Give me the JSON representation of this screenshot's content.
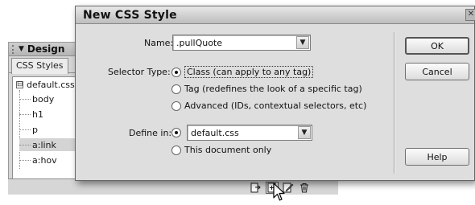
{
  "design_panel": {
    "title": "Design",
    "collapse_arrow": "▼",
    "tab_label": "CSS Styles",
    "tree": {
      "root_expander": "⊟",
      "root": "default.css",
      "items": [
        "body",
        "h1",
        "p",
        "a:link",
        "a:hov"
      ],
      "selected_index": 3
    },
    "toolbar_icons": [
      "attach-style-sheet-icon",
      "new-css-rule-icon",
      "edit-style-icon",
      "delete-icon"
    ]
  },
  "dialog": {
    "title": "New CSS Style",
    "close_glyph": "✕",
    "name": {
      "label": "Name:",
      "value": ".pullQuote"
    },
    "selector_type": {
      "label": "Selector Type:",
      "options": [
        {
          "label": "Class (can apply to any tag)",
          "checked": true
        },
        {
          "label": "Tag (redefines the look of a specific tag)",
          "checked": false
        },
        {
          "label": "Advanced (IDs, contextual selectors, etc)",
          "checked": false
        }
      ]
    },
    "define_in": {
      "label": "Define in:",
      "options": [
        {
          "label": "",
          "value": "default.css",
          "checked": true
        },
        {
          "label": "This document only",
          "checked": false
        }
      ]
    },
    "buttons": {
      "ok": "OK",
      "cancel": "Cancel",
      "help": "Help"
    },
    "dropdown_glyph": "▼"
  }
}
